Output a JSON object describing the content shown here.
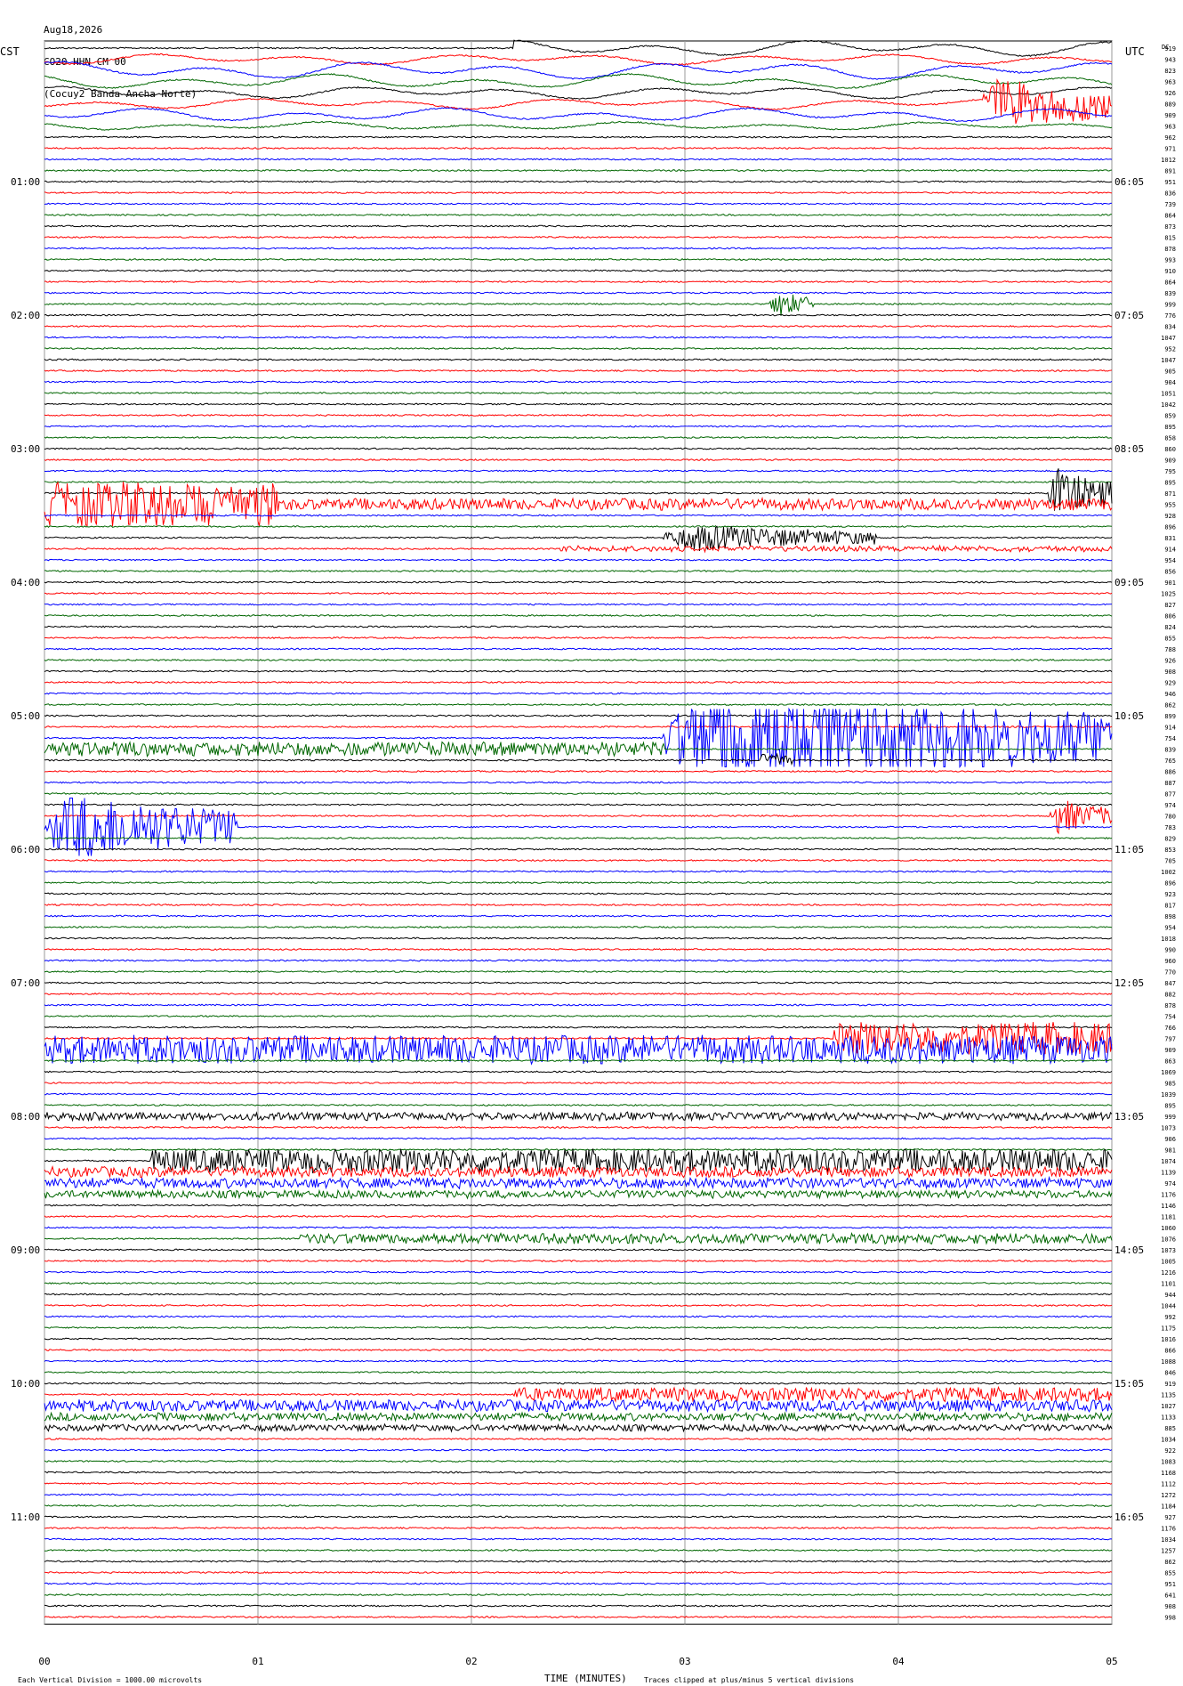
{
  "header": {
    "date": "Aug18,2026",
    "channel": "CO20 HHN CM 00",
    "station": "(Cocuy2 Banda Ancha Norte)"
  },
  "left_timezone": "CST",
  "right_timezone": "UTC",
  "dc_label": "DC",
  "footer": {
    "scale": "Each Vertical Division = 1000.00 microvolts",
    "xlabel": "TIME (MINUTES)",
    "clip_note": "Traces clipped at plus/minus 5 vertical divisions"
  },
  "chart_data": {
    "type": "helicorder",
    "trace_colors": [
      "#000000",
      "#ff0000",
      "#0000ff",
      "#006600"
    ],
    "minutes_per_line": 5,
    "x_ticks": [
      "00",
      "01",
      "02",
      "03",
      "04",
      "05"
    ],
    "cst_labels": [
      {
        "line": 12,
        "label": "01:00"
      },
      {
        "line": 24,
        "label": "02:00"
      },
      {
        "line": 36,
        "label": "03:00"
      },
      {
        "line": 48,
        "label": "04:00"
      },
      {
        "line": 60,
        "label": "05:00"
      },
      {
        "line": 72,
        "label": "06:00"
      },
      {
        "line": 84,
        "label": "07:00"
      },
      {
        "line": 96,
        "label": "08:00"
      },
      {
        "line": 108,
        "label": "09:00"
      },
      {
        "line": 120,
        "label": "10:00"
      },
      {
        "line": 132,
        "label": "11:00"
      }
    ],
    "utc_labels": [
      {
        "line": 12,
        "label": "06:05"
      },
      {
        "line": 24,
        "label": "07:05"
      },
      {
        "line": 36,
        "label": "08:05"
      },
      {
        "line": 48,
        "label": "09:05"
      },
      {
        "line": 60,
        "label": "10:05"
      },
      {
        "line": 72,
        "label": "11:05"
      },
      {
        "line": 84,
        "label": "12:05"
      },
      {
        "line": 96,
        "label": "13:05"
      },
      {
        "line": 108,
        "label": "14:05"
      },
      {
        "line": 120,
        "label": "15:05"
      },
      {
        "line": 132,
        "label": "16:05"
      }
    ],
    "dc_offsets": [
      919,
      943,
      823,
      963,
      926,
      889,
      909,
      963,
      962,
      971,
      1012,
      891,
      951,
      836,
      739,
      864,
      873,
      815,
      878,
      993,
      910,
      864,
      839,
      999,
      776,
      834,
      1047,
      952,
      1047,
      905,
      904,
      1051,
      1042,
      859,
      895,
      858,
      860,
      909,
      795,
      895,
      871,
      955,
      928,
      896,
      831,
      914,
      954,
      856,
      901,
      1025,
      827,
      806,
      824,
      855,
      788,
      926,
      908,
      929,
      946,
      862,
      899,
      914,
      754,
      839,
      765,
      886,
      887,
      877,
      974,
      780,
      783,
      829,
      853,
      705,
      1002,
      896,
      923,
      817,
      898,
      954,
      1018,
      990,
      960,
      770,
      847,
      882,
      878,
      754,
      766,
      797,
      909,
      863,
      1069,
      985,
      1039,
      895,
      999,
      1073,
      906,
      981,
      1074,
      1139,
      974,
      1176,
      1146,
      1181,
      1060,
      1076,
      1073,
      1005,
      1216,
      1101,
      944,
      1044,
      992,
      1175,
      1016,
      866,
      1088,
      846,
      919,
      1135,
      1027,
      1133,
      885,
      1034,
      922,
      1083,
      1168,
      1112,
      1272,
      1184,
      927,
      1176,
      1034,
      1257,
      862,
      855,
      951,
      641,
      908,
      998
    ],
    "events": [
      {
        "line": 0,
        "start_min": 2.2,
        "end_min": 5.0,
        "amp": 1.2,
        "kind": "surface"
      },
      {
        "line": 1,
        "start_min": 0.0,
        "end_min": 5.0,
        "amp": 0.8,
        "kind": "surface"
      },
      {
        "line": 2,
        "start_min": 0.0,
        "end_min": 5.0,
        "amp": 1.3,
        "kind": "surface"
      },
      {
        "line": 3,
        "start_min": 0.0,
        "end_min": 5.0,
        "amp": 1.1,
        "kind": "surface"
      },
      {
        "line": 4,
        "start_min": 0.0,
        "end_min": 5.0,
        "amp": 0.9,
        "kind": "surface"
      },
      {
        "line": 5,
        "start_min": 0.0,
        "end_min": 5.0,
        "amp": 0.8,
        "kind": "surface"
      },
      {
        "line": 5,
        "start_min": 4.4,
        "end_min": 5.0,
        "amp": 2.2,
        "kind": "burst"
      },
      {
        "line": 6,
        "start_min": 0.0,
        "end_min": 5.0,
        "amp": 1.0,
        "kind": "surface"
      },
      {
        "line": 7,
        "start_min": 0.0,
        "end_min": 5.0,
        "amp": 0.6,
        "kind": "surface"
      },
      {
        "line": 23,
        "start_min": 3.4,
        "end_min": 3.6,
        "amp": 1.2,
        "kind": "burst"
      },
      {
        "line": 40,
        "start_min": 4.7,
        "end_min": 5.0,
        "amp": 2.2,
        "kind": "burst"
      },
      {
        "line": 41,
        "start_min": 0.0,
        "end_min": 1.1,
        "amp": 3.6,
        "kind": "noise"
      },
      {
        "line": 41,
        "start_min": 1.1,
        "end_min": 5.0,
        "amp": 0.9,
        "kind": "noise"
      },
      {
        "line": 44,
        "start_min": 2.9,
        "end_min": 3.9,
        "amp": 1.2,
        "kind": "burst"
      },
      {
        "line": 45,
        "start_min": 2.4,
        "end_min": 5.0,
        "amp": 0.4,
        "kind": "noise"
      },
      {
        "line": 62,
        "start_min": 2.9,
        "end_min": 5.0,
        "amp": 5.0,
        "kind": "burst"
      },
      {
        "line": 63,
        "start_min": 0.0,
        "end_min": 2.9,
        "amp": 1.1,
        "kind": "noise"
      },
      {
        "line": 64,
        "start_min": 3.35,
        "end_min": 3.5,
        "amp": 1.0,
        "kind": "burst"
      },
      {
        "line": 69,
        "start_min": 4.7,
        "end_min": 5.0,
        "amp": 1.6,
        "kind": "burst"
      },
      {
        "line": 70,
        "start_min": 0.0,
        "end_min": 0.9,
        "amp": 3.2,
        "kind": "burst"
      },
      {
        "line": 89,
        "start_min": 3.7,
        "end_min": 5.0,
        "amp": 2.6,
        "kind": "noise"
      },
      {
        "line": 90,
        "start_min": 0.0,
        "end_min": 5.0,
        "amp": 2.3,
        "kind": "noise"
      },
      {
        "line": 96,
        "start_min": 0.0,
        "end_min": 5.0,
        "amp": 0.6,
        "kind": "noise"
      },
      {
        "line": 100,
        "start_min": 0.5,
        "end_min": 5.0,
        "amp": 1.9,
        "kind": "noise"
      },
      {
        "line": 101,
        "start_min": 0.0,
        "end_min": 5.0,
        "amp": 0.8,
        "kind": "noise"
      },
      {
        "line": 102,
        "start_min": 0.0,
        "end_min": 5.0,
        "amp": 0.8,
        "kind": "noise"
      },
      {
        "line": 103,
        "start_min": 0.0,
        "end_min": 5.0,
        "amp": 0.6,
        "kind": "noise"
      },
      {
        "line": 107,
        "start_min": 1.2,
        "end_min": 5.0,
        "amp": 0.8,
        "kind": "noise"
      },
      {
        "line": 121,
        "start_min": 2.2,
        "end_min": 5.0,
        "amp": 1.1,
        "kind": "noise"
      },
      {
        "line": 122,
        "start_min": 0.0,
        "end_min": 5.0,
        "amp": 0.9,
        "kind": "noise"
      },
      {
        "line": 123,
        "start_min": 0.0,
        "end_min": 5.0,
        "amp": 0.6,
        "kind": "noise"
      },
      {
        "line": 124,
        "start_min": 0.0,
        "end_min": 5.0,
        "amp": 0.5,
        "kind": "noise"
      },
      {
        "line": 145,
        "start_min": 4.3,
        "end_min": 5.0,
        "amp": 0.6,
        "kind": "noise"
      }
    ]
  }
}
